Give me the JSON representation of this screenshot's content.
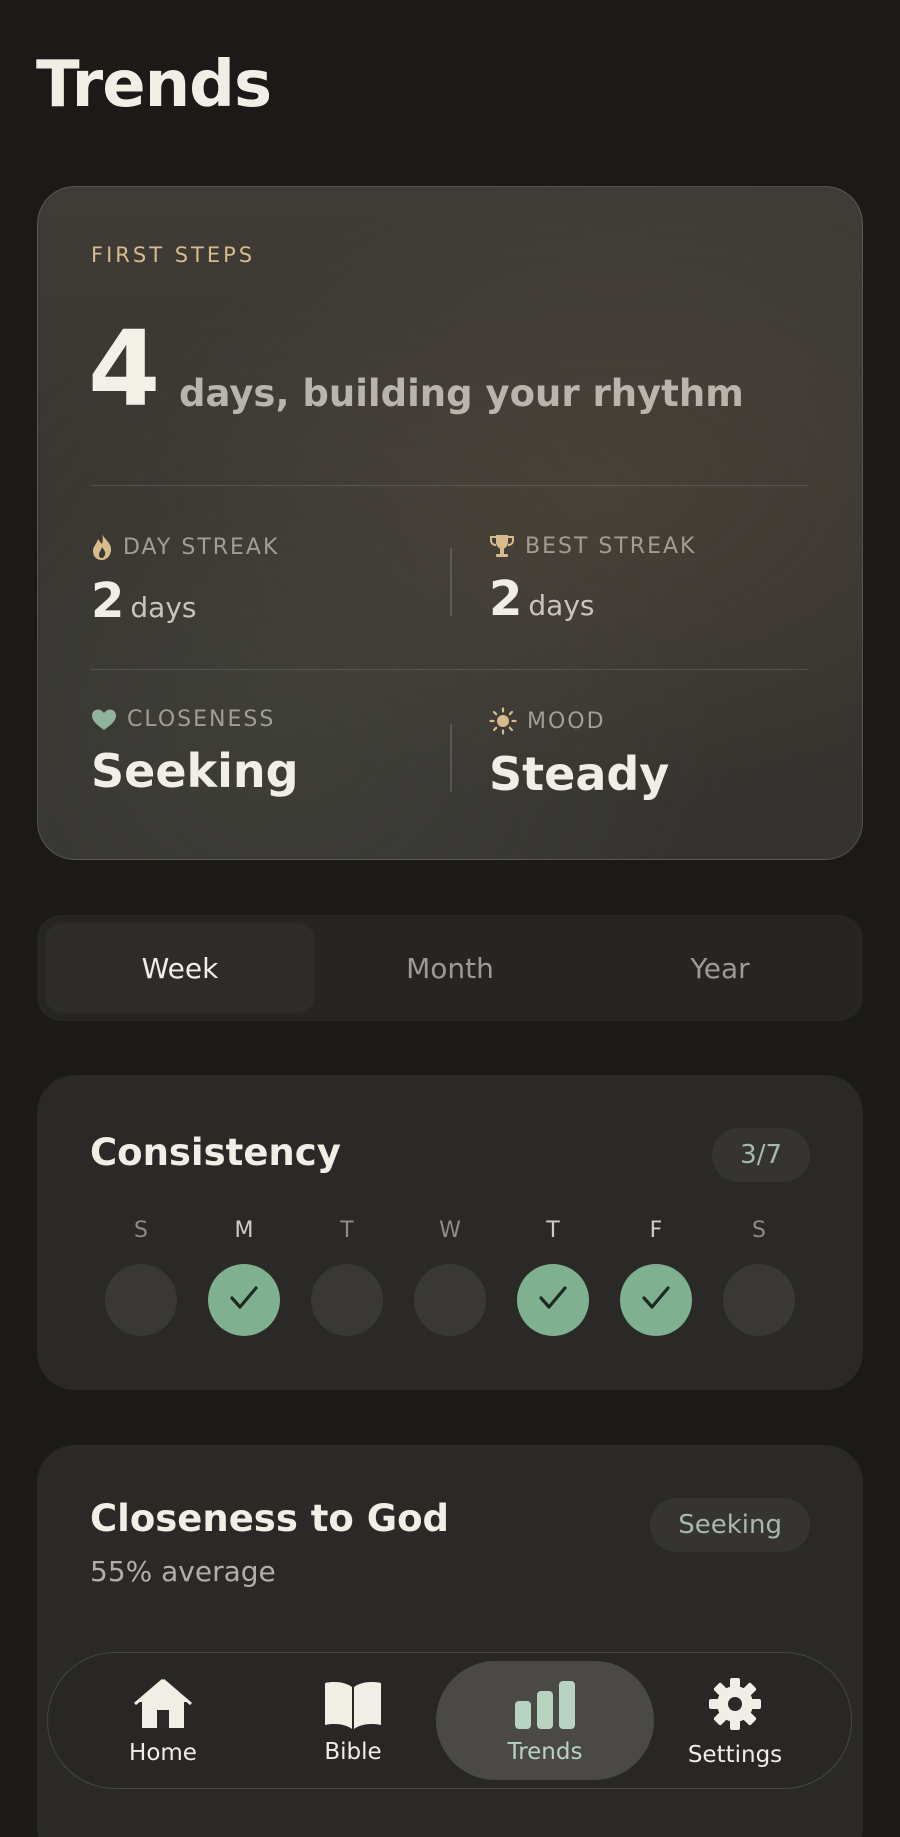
{
  "page": {
    "title": "Trends"
  },
  "hero": {
    "eyebrow": "FIRST STEPS",
    "count": "4",
    "count_text": "days, building your rhythm",
    "stats": {
      "day_streak": {
        "label": "DAY STREAK",
        "value": "2",
        "unit": "days",
        "icon": "flame-icon"
      },
      "best_streak": {
        "label": "BEST STREAK",
        "value": "2",
        "unit": "days",
        "icon": "trophy-icon"
      },
      "closeness": {
        "label": "CLOSENESS",
        "value": "Seeking",
        "icon": "heart-icon"
      },
      "mood": {
        "label": "MOOD",
        "value": "Steady",
        "icon": "sun-icon"
      }
    }
  },
  "range": {
    "options": [
      "Week",
      "Month",
      "Year"
    ],
    "selected": "Week"
  },
  "consistency": {
    "title": "Consistency",
    "badge": "3/7",
    "days": [
      {
        "label": "S",
        "done": false
      },
      {
        "label": "M",
        "done": true
      },
      {
        "label": "T",
        "done": false
      },
      {
        "label": "W",
        "done": false
      },
      {
        "label": "T",
        "done": true
      },
      {
        "label": "F",
        "done": true
      },
      {
        "label": "S",
        "done": false
      }
    ]
  },
  "closeness_card": {
    "title": "Closeness to God",
    "subtitle": "55% average",
    "badge": "Seeking"
  },
  "tabbar": {
    "items": [
      {
        "label": "Home",
        "icon": "home-icon"
      },
      {
        "label": "Bible",
        "icon": "book-icon"
      },
      {
        "label": "Trends",
        "icon": "bar-chart-icon"
      },
      {
        "label": "Settings",
        "icon": "gear-icon"
      }
    ],
    "active": "Trends"
  },
  "colors": {
    "background": "#1b1a18",
    "accent_gold": "#d7bb8c",
    "accent_green": "#7fb08f",
    "trends_active": "#b9d3c1"
  }
}
